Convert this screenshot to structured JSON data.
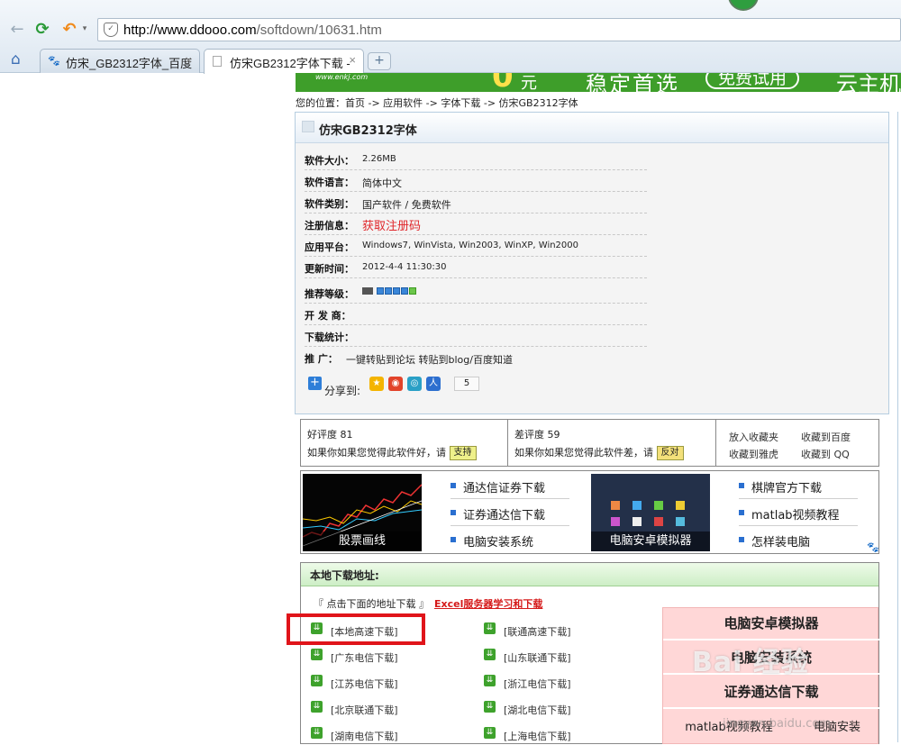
{
  "browser": {
    "url_domain": "http://www.ddooo.com",
    "url_path": "/softdown/10631.htm",
    "tabs": [
      {
        "label": "仿宋_GB2312字体_百度"
      },
      {
        "label": "仿宋GB2312字体下载 -"
      }
    ],
    "new_tab": "+",
    "close": "×"
  },
  "banner": {
    "logo": "www.enkj.com",
    "zero": "0",
    "yuan": "元",
    "slogan": "稳定首选",
    "pill": "免费试用",
    "cloud": "云主机"
  },
  "breadcrumb": "您的位置：首页 -> 应用软件 -> 字体下载 -> 仿宋GB2312字体",
  "software": {
    "title": "仿宋GB2312字体",
    "fields": [
      {
        "key": "软件大小：",
        "value": "2.26MB"
      },
      {
        "key": "软件语言：",
        "value": "简体中文"
      },
      {
        "key": "软件类别：",
        "value": "国产软件 / 免费软件"
      },
      {
        "key": "注册信息：",
        "value": "获取注册码"
      },
      {
        "key": "应用平台：",
        "value": "Windows7, WinVista, Win2003, WinXP, Win2000"
      },
      {
        "key": "更新时间：",
        "value": "2012-4-4 11:30:30"
      },
      {
        "key": "推荐等级：",
        "value": ""
      },
      {
        "key": "开 发 商：",
        "value": ""
      },
      {
        "key": "下载统计：",
        "value": ""
      },
      {
        "key": "推 广：",
        "value": "一键转贴到论坛 转贴到blog/百度知道"
      }
    ],
    "rating_level": 5,
    "share_label": "分享到:",
    "share_count": "5"
  },
  "votes": {
    "good_label": "好评度 81",
    "good_text": "如果你如果您觉得此软件好，请",
    "good_button": "支持",
    "bad_label": "差评度 59",
    "bad_text": "如果你如果您觉得此软件差，请",
    "bad_button": "反对",
    "fav": [
      "放入收藏夹",
      "收藏到百度",
      "收藏到雅虎",
      "收藏到 QQ"
    ]
  },
  "ads": {
    "thumb1": "股票画线",
    "thumb2": "电脑安卓模拟器",
    "links1": [
      "通达信证券下载",
      "证券通达信下载",
      "电脑安装系统"
    ],
    "links2": [
      "棋牌官方下载",
      "matlab视频教程",
      "怎样装电脑"
    ]
  },
  "download": {
    "heading": "本地下载地址:",
    "note": "『 点击下面的地址下载 』",
    "note_link": "Excel服务器学习和下载",
    "left": [
      "[本地高速下载]",
      "[广东电信下载]",
      "[江苏电信下载]",
      "[北京联通下载]",
      "[湖南电信下载]"
    ],
    "right": [
      "[联通高速下载]",
      "[山东联通下载]",
      "[浙江电信下载]",
      "[湖北电信下载]",
      "[上海电信下载]"
    ]
  },
  "promo": {
    "items": [
      "电脑安卓模拟器",
      "电脑安装系统",
      "证券通达信下载"
    ],
    "bottom": [
      "matlab视频教程",
      "电脑安装"
    ]
  },
  "watermark": {
    "main": "Bai  经验",
    "sub": "jingyan.baidu.com"
  }
}
